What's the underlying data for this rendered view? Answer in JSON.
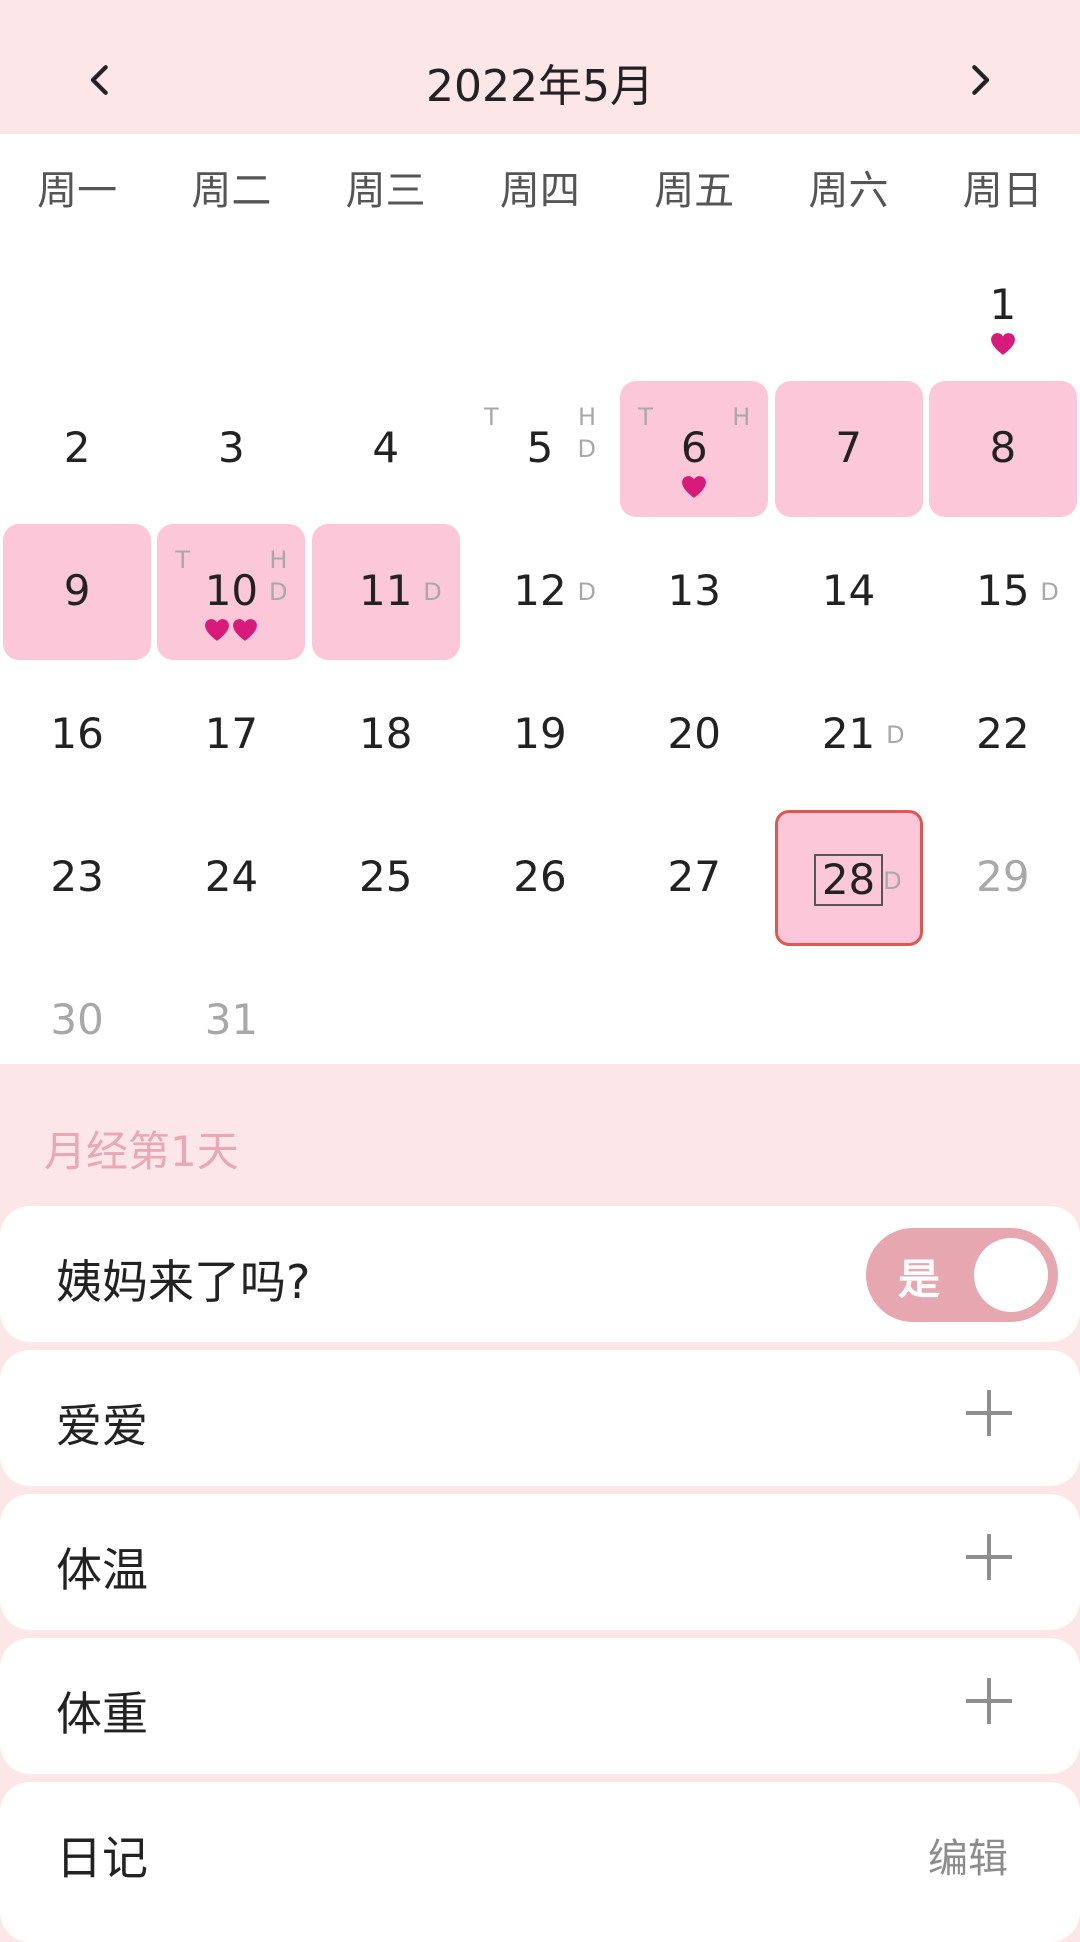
{
  "header": {
    "title": "2022年5月",
    "prev_icon": "chevron-left-icon",
    "next_icon": "chevron-right-icon"
  },
  "weekdays": [
    "周一",
    "周二",
    "周三",
    "周四",
    "周五",
    "周六",
    "周日"
  ],
  "days": [
    {
      "day": "1",
      "hearts": 1
    },
    {
      "day": "2"
    },
    {
      "day": "3"
    },
    {
      "day": "4"
    },
    {
      "day": "5",
      "t": "T",
      "h": "H",
      "d": "D"
    },
    {
      "day": "6",
      "t": "T",
      "h": "H",
      "period": true,
      "hearts": 1
    },
    {
      "day": "7",
      "period": true
    },
    {
      "day": "8",
      "period": true
    },
    {
      "day": "9",
      "period": true
    },
    {
      "day": "10",
      "t": "T",
      "h": "H",
      "d": "D",
      "period": true,
      "hearts": 2
    },
    {
      "day": "11",
      "d": "D",
      "period": true
    },
    {
      "day": "12",
      "d": "D"
    },
    {
      "day": "13"
    },
    {
      "day": "14"
    },
    {
      "day": "15",
      "d": "D"
    },
    {
      "day": "16"
    },
    {
      "day": "17"
    },
    {
      "day": "18"
    },
    {
      "day": "19"
    },
    {
      "day": "20"
    },
    {
      "day": "21",
      "d": "D"
    },
    {
      "day": "22"
    },
    {
      "day": "23"
    },
    {
      "day": "24"
    },
    {
      "day": "25"
    },
    {
      "day": "26"
    },
    {
      "day": "27"
    },
    {
      "day": "28",
      "d": "D",
      "today": true
    },
    {
      "day": "29",
      "dim": true
    },
    {
      "day": "30",
      "dim": true
    },
    {
      "day": "31",
      "dim": true
    }
  ],
  "status": {
    "subtitle": "月经第1天"
  },
  "items": {
    "period_question": "姨妈来了吗?",
    "toggle_label": "是",
    "love": "爱爱",
    "temperature": "体温",
    "weight": "体重",
    "diary": "日记",
    "edit_label": "编辑"
  },
  "colors": {
    "header_bg": "#fde6e8",
    "period_bg": "#fcc8d9",
    "heart": "#d81b7a",
    "today_border": "#e0574f",
    "toggle_bg": "#e6a7b0"
  }
}
